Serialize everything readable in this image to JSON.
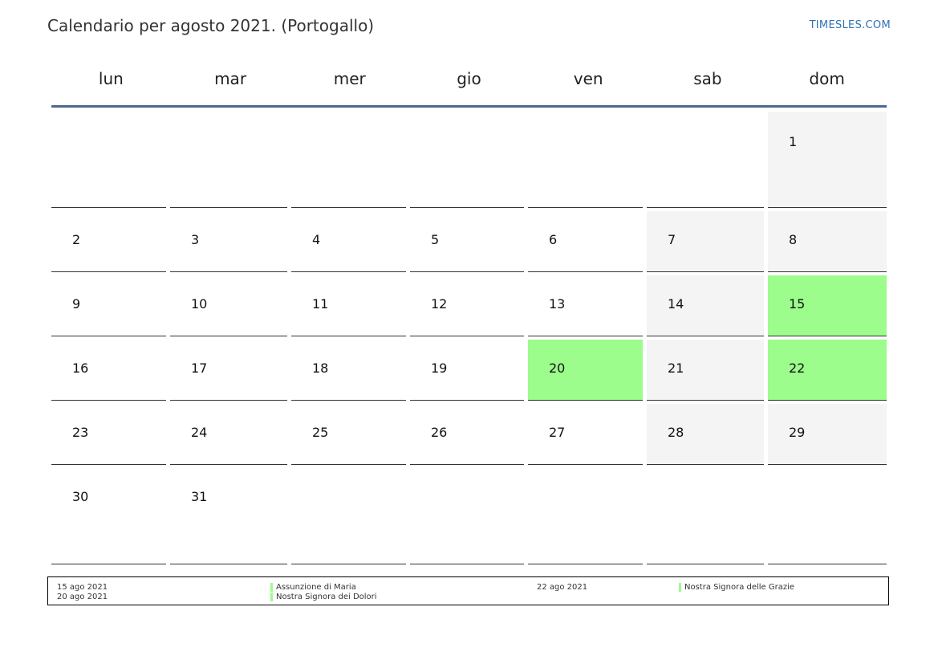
{
  "header": {
    "title": "Calendario per agosto 2021. (Portogallo)",
    "brand": "TIMESLES.COM"
  },
  "weekdays": [
    "lun",
    "mar",
    "mer",
    "gio",
    "ven",
    "sab",
    "dom"
  ],
  "colors": {
    "holiday": "#9cfc8c",
    "weekend": "#f4f4f4",
    "header_rule": "#4a6a8e",
    "brand": "#2f72b4"
  },
  "calendar": {
    "weeks": [
      [
        "",
        "",
        "",
        "",
        "",
        "",
        "1"
      ],
      [
        "2",
        "3",
        "4",
        "5",
        "6",
        "7",
        "8"
      ],
      [
        "9",
        "10",
        "11",
        "12",
        "13",
        "14",
        "15"
      ],
      [
        "16",
        "17",
        "18",
        "19",
        "20",
        "21",
        "22"
      ],
      [
        "23",
        "24",
        "25",
        "26",
        "27",
        "28",
        "29"
      ],
      [
        "30",
        "31",
        "",
        "",
        "",
        "",
        ""
      ]
    ],
    "holidays": [
      "15",
      "20",
      "22"
    ]
  },
  "legend": [
    {
      "date": "15 ago 2021",
      "name": "Assunzione di Maria"
    },
    {
      "date": "20 ago 2021",
      "name": "Nostra Signora dei Dolori"
    },
    {
      "date": "22 ago 2021",
      "name": "Nostra Signora delle Grazie"
    }
  ]
}
